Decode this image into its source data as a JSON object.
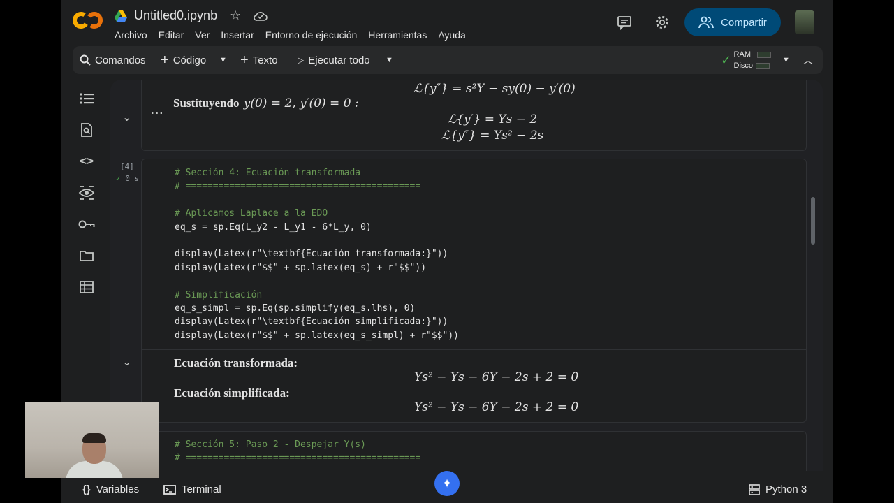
{
  "header": {
    "logo_text": "CO",
    "notebook_title": "Untitled0.ipynb",
    "menu": [
      "Archivo",
      "Editar",
      "Ver",
      "Insertar",
      "Entorno de ejecución",
      "Herramientas",
      "Ayuda"
    ],
    "share_label": "Compartir"
  },
  "toolbar": {
    "commands_label": "Comandos",
    "code_label": "Código",
    "text_label": "Texto",
    "run_all_label": "Ejecutar todo",
    "ram_label": "RAM",
    "disk_label": "Disco"
  },
  "cells": {
    "output_prev": {
      "top_eq": "ℒ{y″} = s²Y − sy(0) − y′(0)",
      "label": "Sustituyendo",
      "label_math": "y(0) = 2,  y′(0) = 0 :",
      "eq1": "ℒ{y′} = Ys − 2",
      "eq2": "ℒ{y″} = Ys² − 2s"
    },
    "code_cell": {
      "exec_count": "[4]",
      "exec_time": "0 s",
      "lines": [
        "# Sección 4: Ecuación transformada",
        "# ===========================================",
        "",
        "# Aplicamos Laplace a la EDO",
        "eq_s = sp.Eq(L_y2 - L_y1 - 6*L_y, 0)",
        "",
        "display(Latex(r\"\\textbf{Ecuación transformada:}\"))",
        "display(Latex(r\"$$\" + sp.latex(eq_s) + r\"$$\"))",
        "",
        "# Simplificación",
        "eq_s_simpl = sp.Eq(sp.simplify(eq_s.lhs), 0)",
        "display(Latex(r\"\\textbf{Ecuación simplificada:}\"))",
        "display(Latex(r\"$$\" + sp.latex(eq_s_simpl) + r\"$$\"))"
      ]
    },
    "output": {
      "label1": "Ecuación transformada:",
      "eq1": "Ys² − Ys − 6Y − 2s + 2 = 0",
      "label2": "Ecuación simplificada:",
      "eq2": "Ys² − Ys − 6Y − 2s + 2 = 0"
    },
    "next_cell": {
      "lines": [
        "# Sección 5: Paso 2 - Despejar Y(s)",
        "# ==========================================="
      ]
    }
  },
  "statusbar": {
    "variables_label": "Variables",
    "terminal_label": "Terminal",
    "kernel_label": "Python 3"
  },
  "colors": {
    "accent": "#004a77",
    "success": "#4caf50"
  }
}
